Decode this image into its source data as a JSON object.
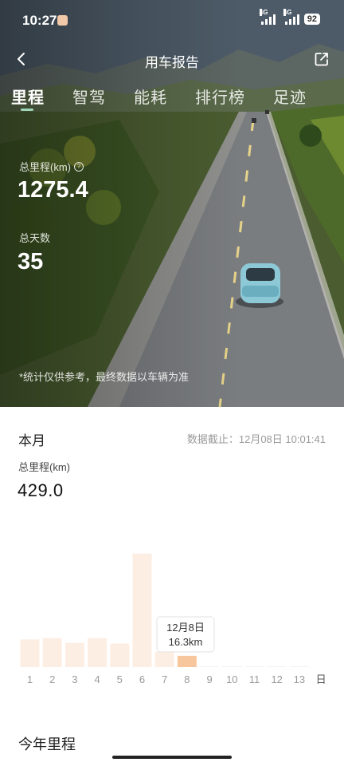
{
  "status_bar": {
    "time": "10:27",
    "network1": "4G",
    "network2": "4G",
    "battery": "92"
  },
  "nav": {
    "title": "用车报告",
    "back_icon": "back-chevron-icon",
    "share_icon": "share-icon"
  },
  "tabs": [
    {
      "label": "里程",
      "active": true
    },
    {
      "label": "智驾",
      "active": false
    },
    {
      "label": "能耗",
      "active": false
    },
    {
      "label": "排行榜",
      "active": false
    },
    {
      "label": "足迹",
      "active": false
    }
  ],
  "hero": {
    "total_mileage_label": "总里程(km)",
    "total_mileage_value": "1275.4",
    "total_days_label": "总天数",
    "total_days_value": "35",
    "disclaimer": "*统计仅供参考，最终数据以车辆为准"
  },
  "month": {
    "title": "本月",
    "data_cutoff": "数据截止：12月08日 10:01:41",
    "total_label": "总里程(km)",
    "total_value": "429.0"
  },
  "tooltip": {
    "date": "12月8日",
    "value": "16.3km"
  },
  "chart_data": {
    "type": "bar",
    "categories": [
      "1",
      "2",
      "3",
      "4",
      "5",
      "6",
      "7",
      "8",
      "9",
      "10",
      "11",
      "12",
      "13"
    ],
    "x_unit": "日",
    "values": [
      40,
      42,
      35,
      42,
      34,
      164,
      22,
      16.3,
      0,
      0,
      0,
      0,
      0
    ],
    "highlighted_index": 7,
    "bar_color": "#fdeee3",
    "highlight_color": "#f7c69d",
    "ylim": [
      0,
      180
    ]
  },
  "year_section": {
    "title": "今年里程"
  }
}
